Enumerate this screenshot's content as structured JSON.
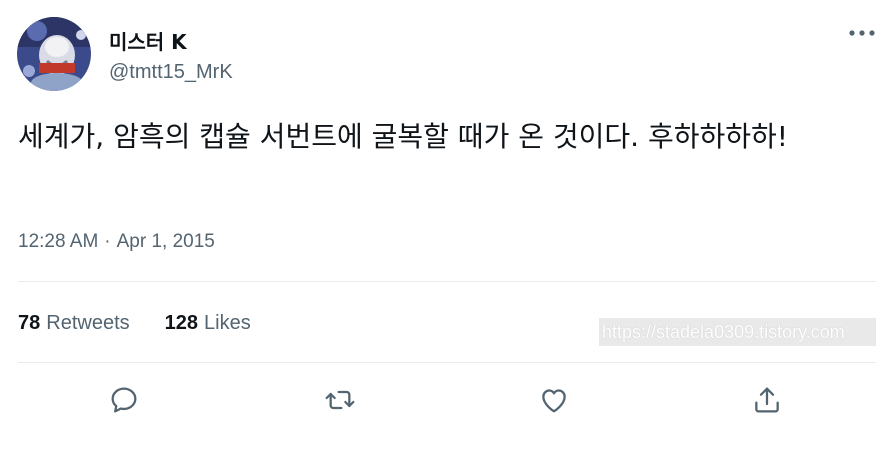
{
  "tweet": {
    "display_name": "미스터 K",
    "handle": "@tmtt15_MrK",
    "text": "세계가, 암흑의 캡슐 서번트에 굴복할 때가 온 것이다. 후하하하하!",
    "time": "12:28 AM",
    "separator": "·",
    "date": "Apr 1, 2015"
  },
  "stats": {
    "retweets_count": "78",
    "retweets_label": "Retweets",
    "likes_count": "128",
    "likes_label": "Likes"
  },
  "watermark": {
    "text": "https://stadela0309.tistory.com"
  },
  "actions": {
    "icons": [
      "reply-icon",
      "retweet-icon",
      "like-icon",
      "share-icon"
    ]
  },
  "colors": {
    "text_primary": "#0f1419",
    "text_secondary": "#536471",
    "divider": "#e6ecf0"
  }
}
